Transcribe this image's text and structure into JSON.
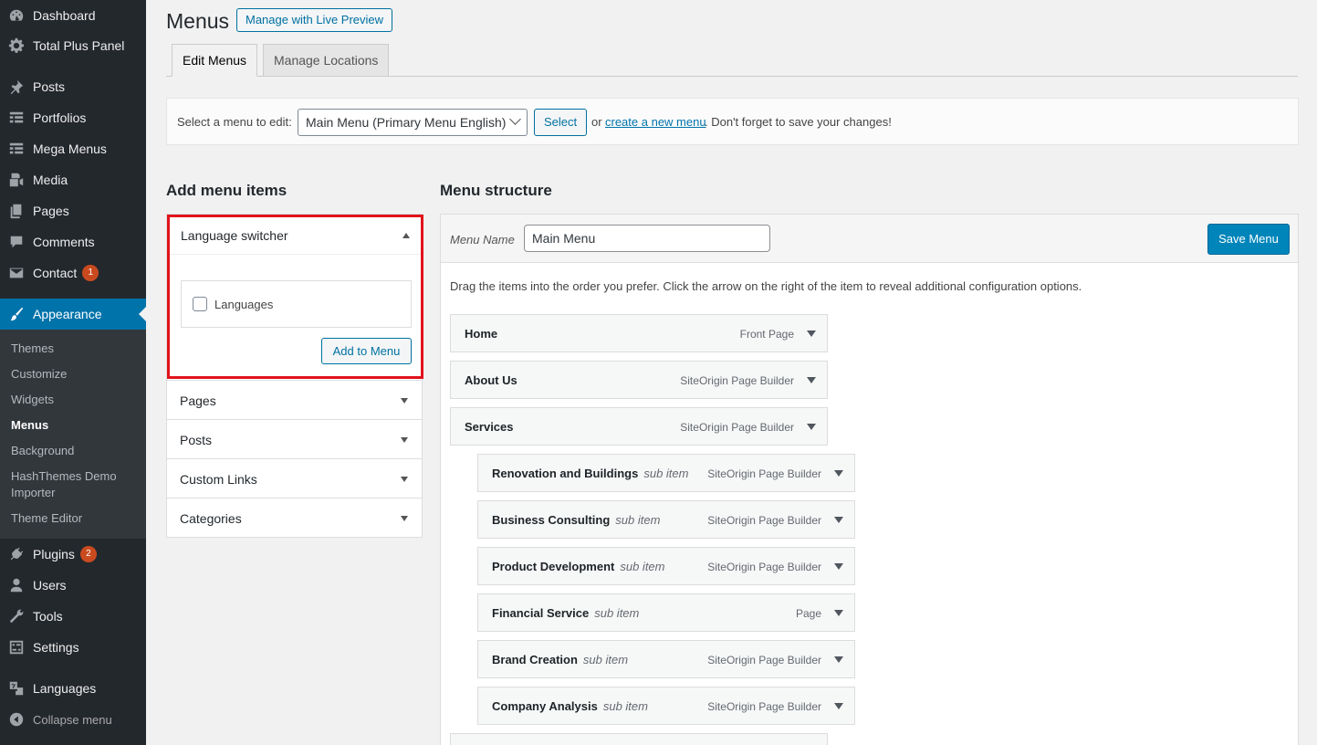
{
  "sidebar": {
    "items": [
      {
        "label": "Dashboard",
        "icon": "dashboard-icon"
      },
      {
        "label": "Total Plus Panel",
        "icon": "gear-icon"
      },
      {
        "label": "Posts",
        "icon": "pin-icon"
      },
      {
        "label": "Portfolios",
        "icon": "grid-icon"
      },
      {
        "label": "Mega Menus",
        "icon": "grid-icon"
      },
      {
        "label": "Media",
        "icon": "media-icon"
      },
      {
        "label": "Pages",
        "icon": "pages-icon"
      },
      {
        "label": "Comments",
        "icon": "comment-icon"
      },
      {
        "label": "Contact",
        "icon": "mail-icon",
        "badge": "1"
      },
      {
        "label": "Appearance",
        "icon": "brush-icon"
      },
      {
        "label": "Plugins",
        "icon": "plug-icon",
        "badge": "2"
      },
      {
        "label": "Users",
        "icon": "user-icon"
      },
      {
        "label": "Tools",
        "icon": "wrench-icon"
      },
      {
        "label": "Settings",
        "icon": "settings-icon"
      },
      {
        "label": "Languages",
        "icon": "translate-icon"
      },
      {
        "label": "Collapse menu",
        "icon": "collapse-icon"
      }
    ],
    "submenu": [
      "Themes",
      "Customize",
      "Widgets",
      "Menus",
      "Background",
      "HashThemes Demo Importer",
      "Theme Editor"
    ]
  },
  "header": {
    "title": "Menus",
    "live_preview_label": "Manage with Live Preview",
    "tabs": [
      "Edit Menus",
      "Manage Locations"
    ]
  },
  "select_bar": {
    "label": "Select a menu to edit:",
    "selected": "Main Menu (Primary Menu English)",
    "button": "Select",
    "or": "or",
    "create_link": "create a new menu",
    "reminder": ". Don't forget to save your changes!"
  },
  "add_items": {
    "title": "Add menu items",
    "language_switcher": {
      "title": "Language switcher",
      "checkbox_label": "Languages",
      "button": "Add to Menu"
    },
    "sections": [
      "Pages",
      "Posts",
      "Custom Links",
      "Categories"
    ]
  },
  "structure": {
    "title": "Menu structure",
    "name_label": "Menu Name",
    "name_value": "Main Menu",
    "save_label": "Save Menu",
    "instructions": "Drag the items into the order you prefer. Click the arrow on the right of the item to reveal additional configuration options.",
    "items": [
      {
        "title": "Home",
        "sub": "",
        "type": "Front Page"
      },
      {
        "title": "About Us",
        "sub": "",
        "type": "SiteOrigin Page Builder"
      },
      {
        "title": "Services",
        "sub": "",
        "type": "SiteOrigin Page Builder"
      },
      {
        "title": "Renovation and Buildings",
        "sub": "sub item",
        "type": "SiteOrigin Page Builder"
      },
      {
        "title": "Business Consulting",
        "sub": "sub item",
        "type": "SiteOrigin Page Builder"
      },
      {
        "title": "Product Development",
        "sub": "sub item",
        "type": "SiteOrigin Page Builder"
      },
      {
        "title": "Financial Service",
        "sub": "sub item",
        "type": "Page"
      },
      {
        "title": "Brand Creation",
        "sub": "sub item",
        "type": "SiteOrigin Page Builder"
      },
      {
        "title": "Company Analysis",
        "sub": "sub item",
        "type": "SiteOrigin Page Builder"
      }
    ]
  },
  "colors": {
    "sidebar_bg": "#23282d",
    "accent": "#0073aa",
    "highlight_border": "#e2121c",
    "badge": "#ca4a1f"
  }
}
